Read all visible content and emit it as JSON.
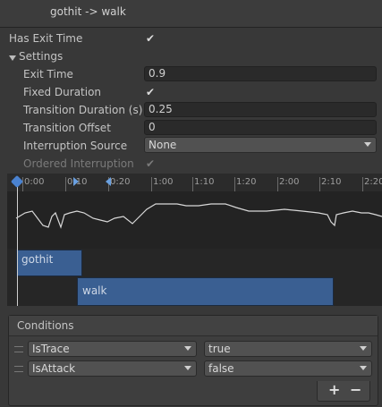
{
  "header": {
    "title": "gothit -> walk"
  },
  "has_exit_time": {
    "label": "Has Exit Time",
    "checked": true
  },
  "settings": {
    "label": "Settings",
    "exit_time": {
      "label": "Exit Time",
      "value": "0.9"
    },
    "fixed_duration": {
      "label": "Fixed Duration",
      "checked": true
    },
    "transition_duration": {
      "label": "Transition Duration (s)",
      "value": "0.25"
    },
    "transition_offset": {
      "label": "Transition Offset",
      "value": "0"
    },
    "interruption_source": {
      "label": "Interruption Source",
      "value": "None"
    },
    "ordered_interruption": {
      "label": "Ordered Interruption",
      "checked": true
    }
  },
  "timeline": {
    "ticks": [
      "0:00",
      "0:10",
      "0:20",
      "1:00",
      "1:10",
      "1:20",
      "2:00",
      "2:10",
      "2:20"
    ],
    "clips": {
      "source": "gothit",
      "destination": "walk"
    }
  },
  "conditions": {
    "title": "Conditions",
    "rows": [
      {
        "parameter": "IsTrace",
        "value": "true"
      },
      {
        "parameter": "IsAttack",
        "value": "false"
      }
    ],
    "add_label": "+",
    "remove_label": "−"
  },
  "colors": {
    "clip_blue": "#3a5f92",
    "highlight_blue": "#466eaa",
    "panel_bg": "#383838"
  },
  "icons": [
    "checkmark-icon",
    "foldout-arrow-icon",
    "dropdown-arrow-icon",
    "playhead-marker-icon",
    "drag-handle-icon"
  ]
}
